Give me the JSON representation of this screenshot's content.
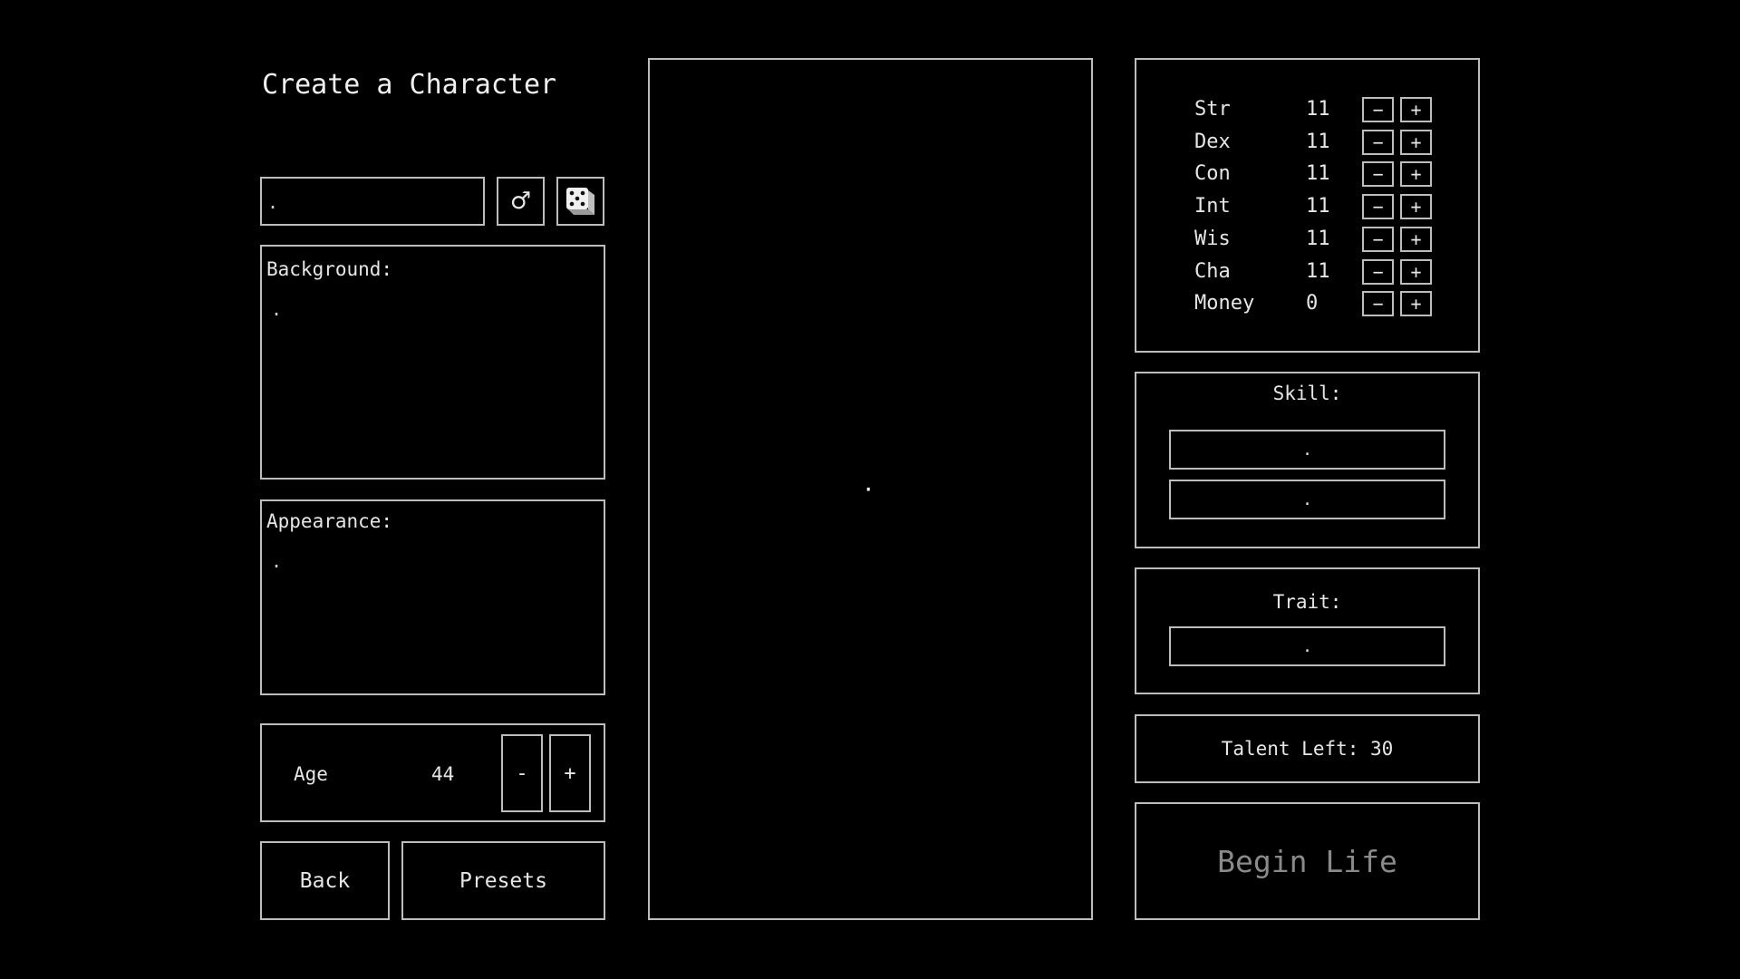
{
  "header": {
    "title": "Create a Character"
  },
  "name_input": {
    "value": "."
  },
  "gender_toggle": {
    "glyph": "♂",
    "icon": "male-symbol-icon"
  },
  "randomize": {
    "icon": "dice-icon"
  },
  "background": {
    "label": "Background:",
    "value": "."
  },
  "appearance": {
    "label": "Appearance:",
    "value": "."
  },
  "age": {
    "label": "Age",
    "value": "44",
    "minus": "-",
    "plus": "+"
  },
  "buttons": {
    "back": "Back",
    "presets": "Presets",
    "begin": "Begin Life"
  },
  "stats": [
    {
      "name": "Str",
      "value": "11"
    },
    {
      "name": "Dex",
      "value": "11"
    },
    {
      "name": "Con",
      "value": "11"
    },
    {
      "name": "Int",
      "value": "11"
    },
    {
      "name": "Wis",
      "value": "11"
    },
    {
      "name": "Cha",
      "value": "11"
    },
    {
      "name": "Money",
      "value": "0"
    }
  ],
  "stat_buttons": {
    "minus": "−",
    "plus": "+"
  },
  "skill": {
    "label": "Skill:",
    "slots": [
      ".",
      "."
    ]
  },
  "trait": {
    "label": "Trait:",
    "slots": [
      "."
    ]
  },
  "talent": {
    "label": "Talent Left: 30"
  },
  "preview": {
    "marker": "·"
  },
  "colors": {
    "border": "#bdbdbd",
    "text": "#e6e6e6",
    "disabled_text": "#8a8a8a",
    "background": "#000000"
  }
}
